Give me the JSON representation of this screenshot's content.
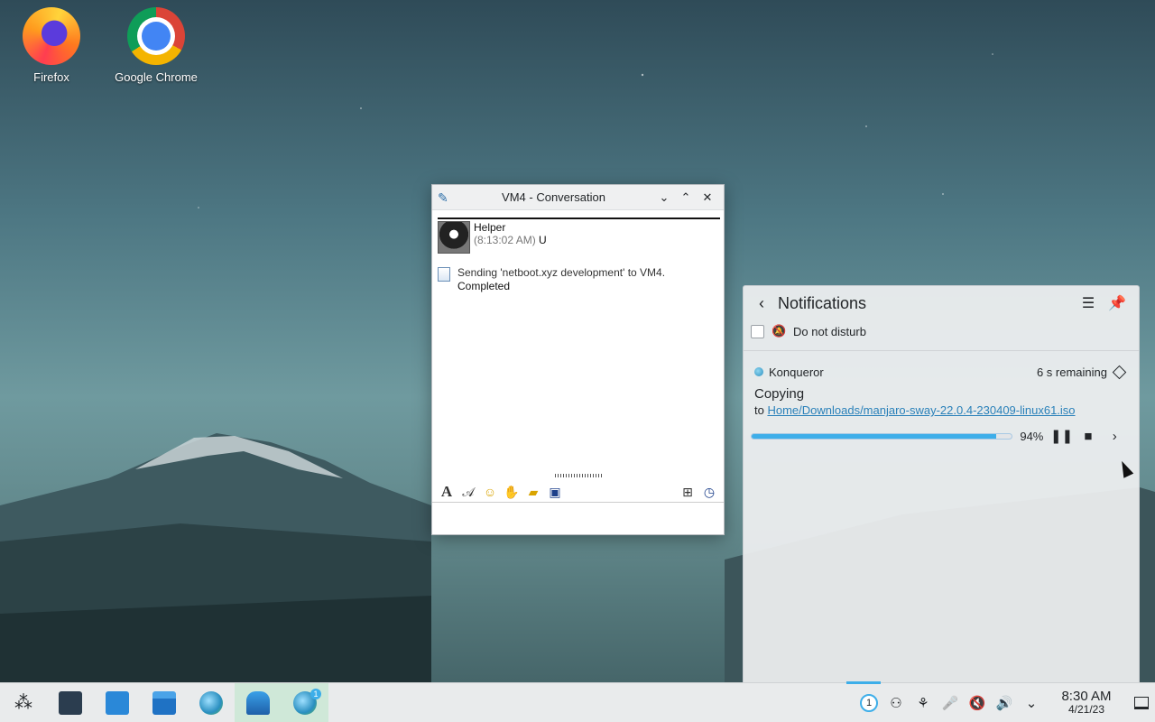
{
  "desktop": {
    "icons": [
      {
        "label": "Firefox"
      },
      {
        "label": "Google Chrome"
      }
    ]
  },
  "conversation": {
    "title": "VM4 - Conversation",
    "sender": "Helper",
    "time": "(8:13:02 AM)",
    "status_marker": "U",
    "file_message": "Sending 'netboot.xyz  development' to VM4.",
    "file_status": "Completed",
    "colors": {
      "titlebar": "#eff0f1"
    }
  },
  "notifications": {
    "title": "Notifications",
    "do_not_disturb_label": "Do not disturb",
    "job": {
      "app": "Konqueror",
      "remaining": "6 s remaining",
      "title": "Copying",
      "dest_prefix": "to",
      "dest_path": "Home/Downloads/manjaro-sway-22.0.4-230409-linux61.iso",
      "progress_percent": 94,
      "progress_label": "94%"
    },
    "accent_color": "#3daee9"
  },
  "taskbar": {
    "virtual_desktop": "1",
    "kopete_badge": "1",
    "clock_time": "8:30 AM",
    "clock_date": "4/21/23"
  }
}
